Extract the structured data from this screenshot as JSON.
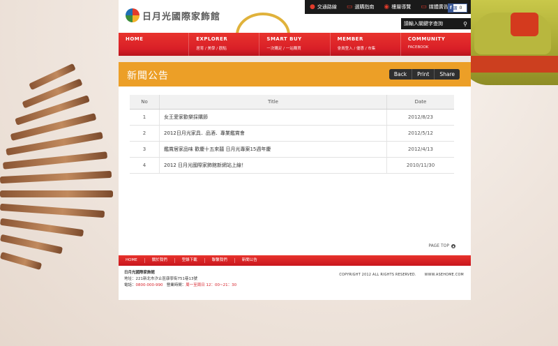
{
  "header": {
    "logo_text": "日月光國際家飾館",
    "top_links": [
      {
        "label": "交通路線",
        "icon": "map-pin-icon"
      },
      {
        "label": "選購指南",
        "icon": "chat-icon"
      },
      {
        "label": "樓層導覽",
        "icon": "compass-icon"
      },
      {
        "label": "媒體廣告",
        "icon": "speech-icon"
      }
    ],
    "fb": {
      "label": "讚",
      "count": "0"
    },
    "search_placeholder": "請輸入關鍵字查詢"
  },
  "nav": [
    {
      "title": "HOME",
      "sub": ""
    },
    {
      "title": "EXPLORER",
      "sub": "居育 / 美學 / 觀點"
    },
    {
      "title": "SMART BUY",
      "sub": "一次購足 / 一站購買"
    },
    {
      "title": "MEMBER",
      "sub": "會員登入 / 優惠 / 市集"
    },
    {
      "title": "COMMUNITY",
      "sub": "FACEBOOK"
    }
  ],
  "page": {
    "title": "新聞公告",
    "actions": {
      "back": "Back",
      "print": "Print",
      "share": "Share"
    }
  },
  "table": {
    "headers": {
      "no": "No",
      "title": "Title",
      "date": "Date"
    },
    "rows": [
      {
        "no": "1",
        "title": "女王愛家歡樂採購節",
        "date": "2012/8/23"
      },
      {
        "no": "2",
        "title": "2012日月光家具．品酒．專業鑑賞會",
        "date": "2012/5/12"
      },
      {
        "no": "3",
        "title": "鑑賞居家品味 歡慶十五來囍 日月光專案15週年慶",
        "date": "2012/4/13"
      },
      {
        "no": "4",
        "title": "2012 日月光國際家飾館新網站上線！",
        "date": "2010/11/30"
      }
    ]
  },
  "page_top": "PAGE TOP",
  "footer": {
    "nav": [
      "HOME",
      "關於我們",
      "型錄下載",
      "聯繫我們",
      "新聞公告"
    ],
    "name": "日月光國際家飾館",
    "address": "地址：221新北市汐止區康寧街751巷13號",
    "phone_label": "電話：",
    "phone": "0800-000-990",
    "hours_label": "營業時間：",
    "hours": "周一至周日 12：00~21：30",
    "copyright": "COPYRIGHT 2012  ALL RIGHTS RESERVED.",
    "website": "WWW.ASEHOME.COM"
  },
  "colors": {
    "accent_red": "#d91f27",
    "title_orange": "#ec9f27",
    "dark": "#1a1a1a"
  }
}
